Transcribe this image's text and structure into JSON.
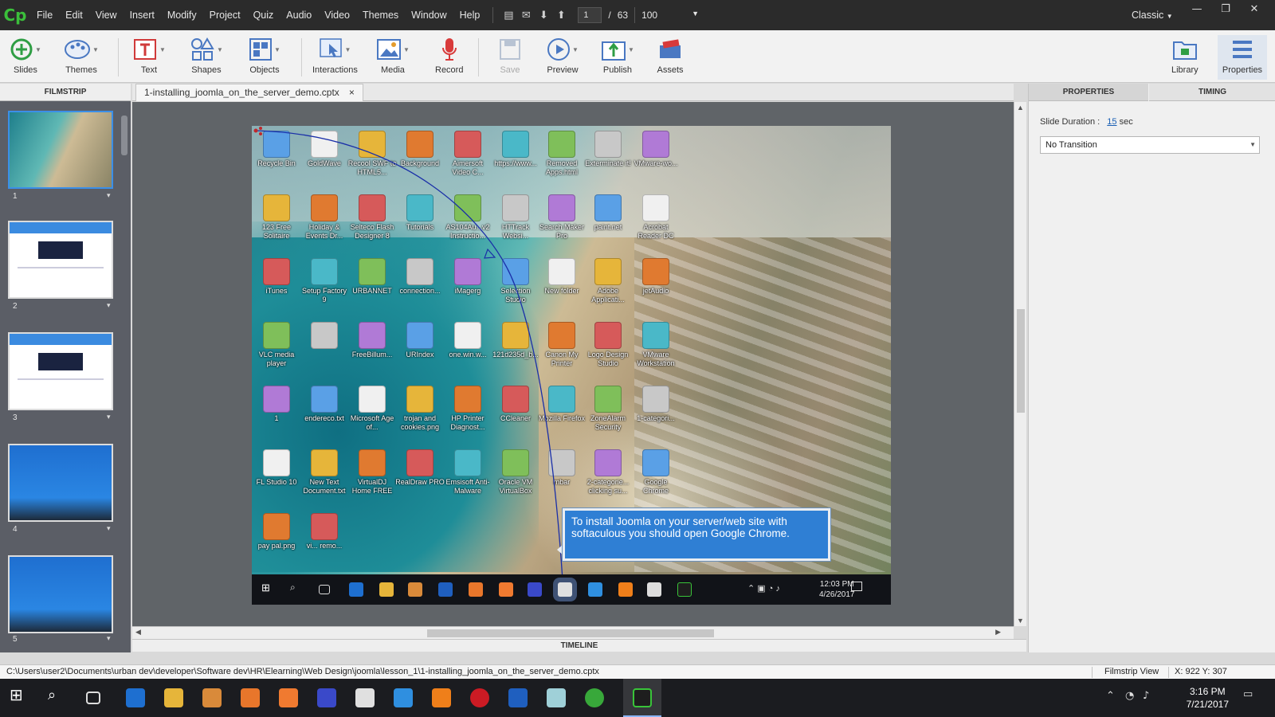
{
  "app": {
    "logo": "Cp",
    "mode": "Classic"
  },
  "menu": [
    "File",
    "Edit",
    "View",
    "Insert",
    "Modify",
    "Project",
    "Quiz",
    "Audio",
    "Video",
    "Themes",
    "Window",
    "Help"
  ],
  "navigation": {
    "current_slide": "1",
    "separator": "/",
    "total_slides": "63",
    "zoom": "100"
  },
  "toolbar": {
    "slides": "Slides",
    "themes": "Themes",
    "text": "Text",
    "shapes": "Shapes",
    "objects": "Objects",
    "interactions": "Interactions",
    "media": "Media",
    "record": "Record",
    "save": "Save",
    "preview": "Preview",
    "publish": "Publish",
    "assets": "Assets",
    "library": "Library",
    "properties": "Properties"
  },
  "filmstrip": {
    "header": "FILMSTRIP",
    "thumbnails": [
      {
        "num": "1"
      },
      {
        "num": "2"
      },
      {
        "num": "3"
      },
      {
        "num": "4"
      },
      {
        "num": "5"
      }
    ]
  },
  "document_tab": {
    "name": "1-installing_joomla_on_the_server_demo.cptx",
    "close": "×"
  },
  "slide": {
    "icons": [
      "Recycle Bin",
      "GoldWave",
      "Recool SWF to HTML5...",
      "Background",
      "Aimersoft Video C...",
      "https://www...",
      "Removed Apps.html",
      "Exterminate it!",
      "VMware-wo...",
      "123 Free Solitaire",
      "Holiday & Events Dr...",
      "Selteco Flash Designer 8",
      "Tutorials",
      "AS104Au...v2 Instructio...",
      "HTTrack Websi...",
      "Search Maker Pro",
      "paint.net",
      "Acrobat Reader DC",
      "iTunes",
      "Setup Factory 9",
      "URBANNET",
      "connection...",
      "iMagerg",
      "Selection Studio",
      "New folder",
      "Adobe Applicati...",
      "jetAudio",
      "VLC media player",
      "",
      "FreeBillum...",
      "URIndex",
      "one.win.w...",
      "121d235d_b...",
      "Canon My Printer",
      "Logo Design Studio",
      "VMware Workstation",
      "1",
      "endereco.txt",
      "Microsoft Age of...",
      "trojan and cookies.png",
      "HP Printer Diagnost...",
      "CCleaner",
      "Mozilla Firefox",
      "ZoneAlarm Security",
      "1-categori...",
      "FL Studio 10",
      "New Text Document.txt",
      "VirtualDJ Home FREE",
      "RealDraw PRO",
      "Emsisoft Anti-Malware",
      "Oracle VM VirtualBox",
      "mbar",
      "2-categorie... clicking su...",
      "Google Chrome",
      "pay pal.png",
      "vi... remo..."
    ],
    "caption": "To install Joomla on your server/web site with softaculous you should open Google Chrome.",
    "clock_time": "12:03 PM",
    "clock_date": "4/26/2017"
  },
  "properties": {
    "tab_properties": "PROPERTIES",
    "tab_timing": "TIMING",
    "slide_duration_label": "Slide Duration :",
    "slide_duration_value": "15",
    "slide_duration_unit": "sec",
    "transition": "No Transition"
  },
  "timeline": "TIMELINE",
  "status": {
    "path": "C:\\Users\\user2\\Documents\\urban dev\\developer\\Software dev\\HR\\Elearning\\Web Design\\joomla\\lesson_1\\1-installing_joomla_on_the_server_demo.cptx",
    "view": "Filmstrip View",
    "coords": "X: 922 Y: 307"
  },
  "taskbar": {
    "time": "3:16 PM",
    "date": "7/21/2017"
  }
}
